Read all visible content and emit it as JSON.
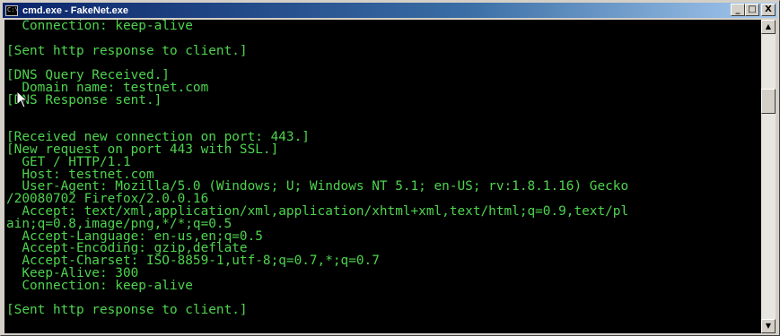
{
  "window": {
    "title": "cmd.exe - FakeNet.exe",
    "icon_text": "C:\\",
    "minimize_label": "_",
    "maximize_label": "□",
    "close_label": "X"
  },
  "console": {
    "text_color": "#4ed44e",
    "background": "#000000",
    "lines": [
      "  Connection: keep-alive",
      "",
      "[Sent http response to client.]",
      "",
      "[DNS Query Received.]",
      "  Domain name: testnet.com",
      "[DNS Response sent.]",
      "",
      "",
      "[Received new connection on port: 443.]",
      "[New request on port 443 with SSL.]",
      "  GET / HTTP/1.1",
      "  Host: testnet.com",
      "  User-Agent: Mozilla/5.0 (Windows; U; Windows NT 5.1; en-US; rv:1.8.1.16) Gecko",
      "/20080702 Firefox/2.0.0.16",
      "  Accept: text/xml,application/xml,application/xhtml+xml,text/html;q=0.9,text/pl",
      "ain;q=0.8,image/png,*/*;q=0.5",
      "  Accept-Language: en-us,en;q=0.5",
      "  Accept-Encoding: gzip,deflate",
      "  Accept-Charset: ISO-8859-1,utf-8;q=0.7,*;q=0.7",
      "  Keep-Alive: 300",
      "  Connection: keep-alive",
      "",
      "[Sent http response to client.]",
      ""
    ]
  },
  "scrollbar": {
    "up_label": "▲",
    "down_label": "▼"
  }
}
